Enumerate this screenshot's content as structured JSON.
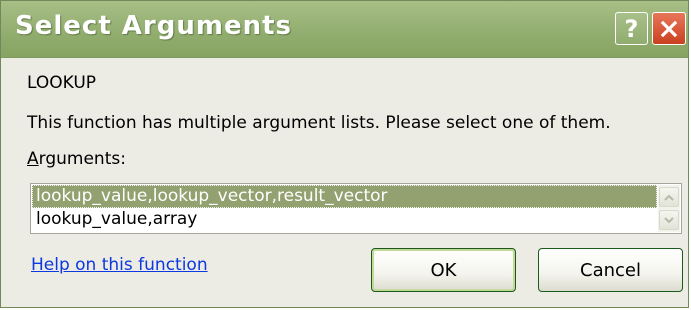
{
  "window": {
    "title": "Select Arguments",
    "help_glyph": "?",
    "close_icon": "close-x-icon"
  },
  "dialog": {
    "function_name": "LOOKUP",
    "description": "This function has multiple argument lists.  Please select one of them.",
    "arguments_label_accesskey": "A",
    "arguments_label_rest": "rguments:",
    "argument_lists": [
      {
        "label": "lookup_value,lookup_vector,result_vector",
        "selected": true
      },
      {
        "label": "lookup_value,array",
        "selected": false
      }
    ],
    "help_link": "Help on this function",
    "ok_label": "OK",
    "cancel_label": "Cancel"
  },
  "colors": {
    "titlebar": "#91ad6e",
    "selection": "#93a070",
    "close_button": "#d4532f",
    "link": "#0b38e0",
    "dialog_bg": "#ecebe4"
  }
}
